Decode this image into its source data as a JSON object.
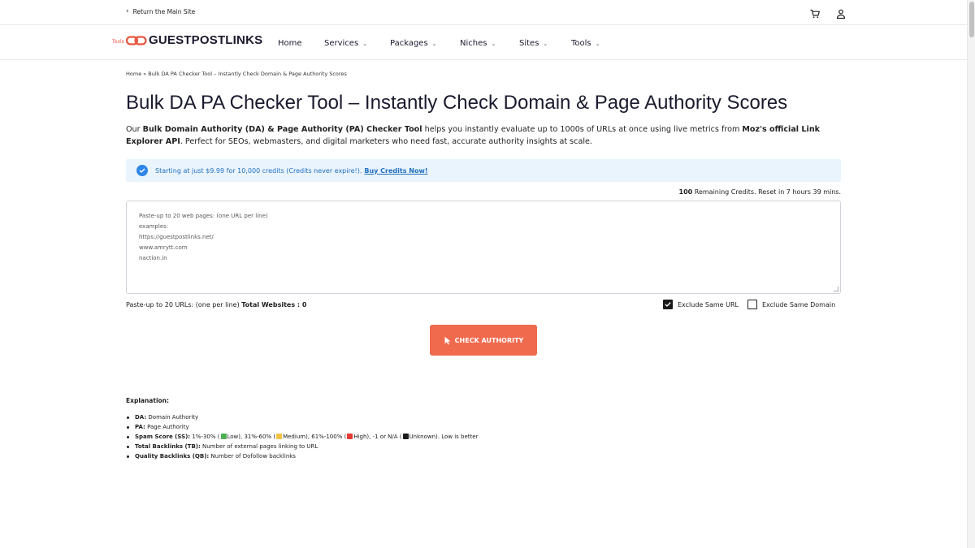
{
  "topbar": {
    "return_label": "Return the Main Site",
    "icons": [
      "cart-icon",
      "user-icon"
    ]
  },
  "logo": {
    "text": "GUESTPOSTLINKS",
    "sub": "Tools",
    "mark_color": "#e8553f"
  },
  "nav": {
    "items": [
      {
        "label": "Home",
        "dropdown": false
      },
      {
        "label": "Services",
        "dropdown": true
      },
      {
        "label": "Packages",
        "dropdown": true
      },
      {
        "label": "Niches",
        "dropdown": true
      },
      {
        "label": "Sites",
        "dropdown": true
      },
      {
        "label": "Tools",
        "dropdown": true
      }
    ]
  },
  "breadcrumb": "Home » Bulk DA PA Checker Tool – Instantly Check Domain & Page Authority Scores",
  "page_title": "Bulk DA PA Checker Tool – Instantly Check Domain & Page Authority Scores",
  "intro": {
    "p1": "Our ",
    "b1": "Bulk Domain Authority (DA) & Page Authority (PA) Checker Tool",
    "p2": " helps you instantly evaluate up to 1000s of URLs at once using live metrics from ",
    "b2": "Moz's official Link Explorer API",
    "p3": ". Perfect for SEOs, webmasters, and digital marketers who need fast, accurate authority insights at scale."
  },
  "banner": {
    "text": "Starting at just $9.99 for 10,000 credits (Credits never expire!).",
    "link": "Buy Credits Now!",
    "color": "#1f6fbf",
    "background": "#eaf4fd"
  },
  "credits": {
    "count": "100",
    "text": " Remaining Credits. Reset in 7 hours 39 mins."
  },
  "textarea": {
    "value": "",
    "placeholder_lines": [
      "Paste-up to 20 web pages: (one URL per line)",
      "examples:",
      "https://guestpostlinks.net/",
      "www.amrytt.com",
      "naction.in"
    ]
  },
  "helper": {
    "text": "Paste-up to 20 URLs: (one per line) ",
    "total_label": "Total Websites : 0"
  },
  "options": {
    "exclude_url": {
      "label": "Exclude Same URL",
      "checked": true
    },
    "exclude_domain": {
      "label": "Exclude Same Domain",
      "checked": false
    }
  },
  "check_button": {
    "label": "CHECK AUTHORITY",
    "color": "#f06a4e"
  },
  "explanation": {
    "title": "Explanation:",
    "da": {
      "term": "DA:",
      "desc": " Domain Authority"
    },
    "pa": {
      "term": "PA:",
      "desc": " Page Authority"
    },
    "ss": {
      "term": "Spam Score (SS):",
      "p1": " 1%-30% (",
      "low": "Low), 31%-60% (",
      "medium": "Medium), 61%-100% (",
      "high": "High), -1 or N/A (",
      "unknown": "Unknown). Low is better",
      "colors": {
        "low": "#4caf50",
        "medium": "#f5c242",
        "high": "#e53935",
        "unknown": "#1a1a1a"
      }
    },
    "tb": {
      "term": "Total Backlinks (TB):",
      "desc": " Number of external pages linking to URL"
    },
    "qb": {
      "term": "Quality Backlinks (QB):",
      "desc": " Number of Dofollow backlinks"
    }
  }
}
